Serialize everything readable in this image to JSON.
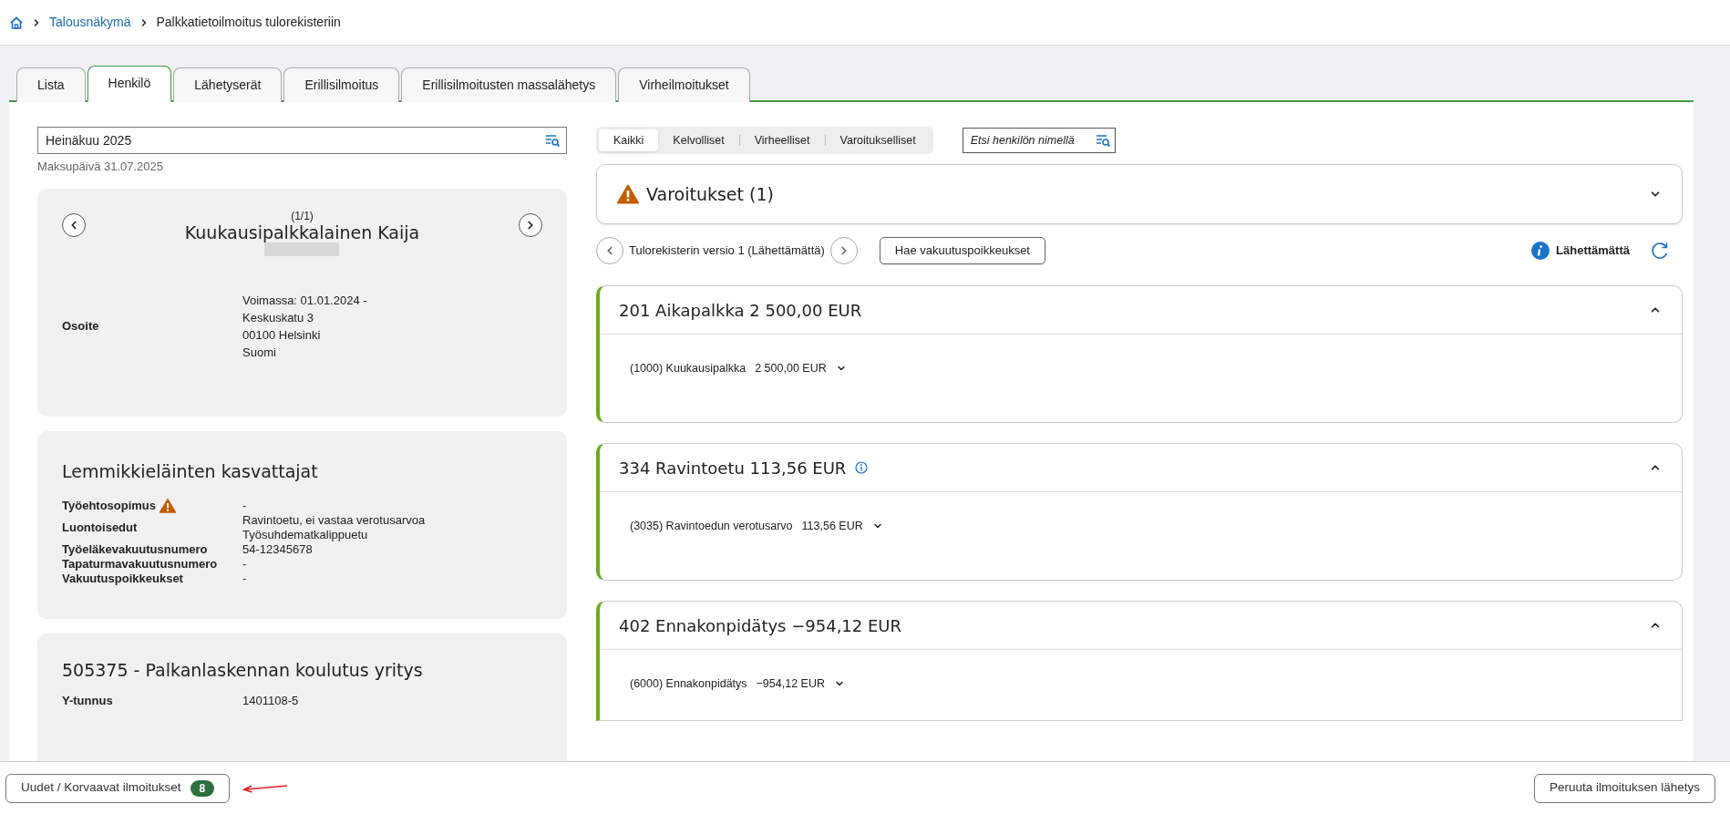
{
  "breadcrumb": [
    {
      "label": "Talousnäkymä",
      "kind": "link"
    },
    {
      "label": "Palkkatietoilmoitus tulorekisteriin",
      "kind": "current"
    }
  ],
  "tabs": [
    {
      "label": "Lista",
      "selected": false
    },
    {
      "label": "Henkilö",
      "selected": true
    },
    {
      "label": "Lähetyserät",
      "selected": false
    },
    {
      "label": "Erillisilmoitus",
      "selected": false
    },
    {
      "label": "Erillisilmoitusten massalähetys",
      "selected": false
    },
    {
      "label": "Virheilmoitukset",
      "selected": false
    }
  ],
  "period_field": {
    "value": "Heinäkuu 2025"
  },
  "payment_date": "Maksupäivä 31.07.2025",
  "person_card": {
    "counter": "(1/1)",
    "name": "Kuukausipalkkalainen Kaija",
    "fields": [
      {
        "label": "Osoite",
        "warning": false,
        "values": [
          "Voimassa: 01.01.2024 -",
          "Keskuskatu 3",
          "00100 Helsinki",
          "Suomi"
        ]
      }
    ]
  },
  "employment_card": {
    "title": "Lemmikkieläinten kasvattajat",
    "fields": [
      {
        "label": "Työehtosopimus",
        "warning": true,
        "values": [
          "-"
        ]
      },
      {
        "label": "Luontoisedut",
        "warning": false,
        "values": [
          "Ravintoetu, ei vastaa verotusarvoa",
          "Työsuhdematkalippuetu"
        ]
      },
      {
        "label": "Työeläkevakuutusnumero",
        "warning": false,
        "values": [
          "54-12345678"
        ]
      },
      {
        "label": "Tapaturmavakuutusnumero",
        "warning": false,
        "values": [
          "-"
        ]
      },
      {
        "label": "Vakuutuspoikkeukset",
        "warning": false,
        "values": [
          "-"
        ]
      }
    ]
  },
  "employer_card": {
    "title": "505375 - Palkanlaskennan koulutus yritys",
    "fields": [
      {
        "label": "Y-tunnus",
        "warning": false,
        "values": [
          "1401108-5"
        ]
      }
    ]
  },
  "filters": [
    {
      "label": "Kaikki",
      "selected": true
    },
    {
      "label": "Kelvolliset",
      "selected": false
    },
    {
      "label": "Virheelliset",
      "selected": false
    },
    {
      "label": "Varoitukselliset",
      "selected": false
    }
  ],
  "name_search": {
    "placeholder": "Etsi henkilön nimellä"
  },
  "warnings": {
    "title": "Varoitukset (1)",
    "expanded": false
  },
  "version": {
    "label": "Tulorekisterin versio 1 (Lähettämättä)"
  },
  "fetch_button": "Hae vakuutuspoikkeukset",
  "status": "Lähettämättä",
  "income_types": [
    {
      "title": "201 Aikapalkka 2 500,00 EUR",
      "info": false,
      "expanded": true,
      "items": [
        {
          "label": "(1000) Kuukausipalkka",
          "amount": "2 500,00 EUR"
        }
      ]
    },
    {
      "title": "334 Ravintoetu 113,56 EUR",
      "info": true,
      "expanded": true,
      "items": [
        {
          "label": "(3035) Ravintoedun verotusarvo",
          "amount": "113,56 EUR"
        }
      ]
    },
    {
      "title": "402 Ennakonpidätys −954,12 EUR",
      "info": false,
      "expanded": true,
      "items": [
        {
          "label": "(6000) Ennakonpidätys",
          "amount": "−954,12 EUR"
        }
      ]
    }
  ],
  "footer": {
    "new_button": {
      "label": "Uudet / Korvaavat ilmoitukset",
      "count": "8"
    },
    "cancel_button": "Peruuta ilmoituksen lähetys"
  }
}
